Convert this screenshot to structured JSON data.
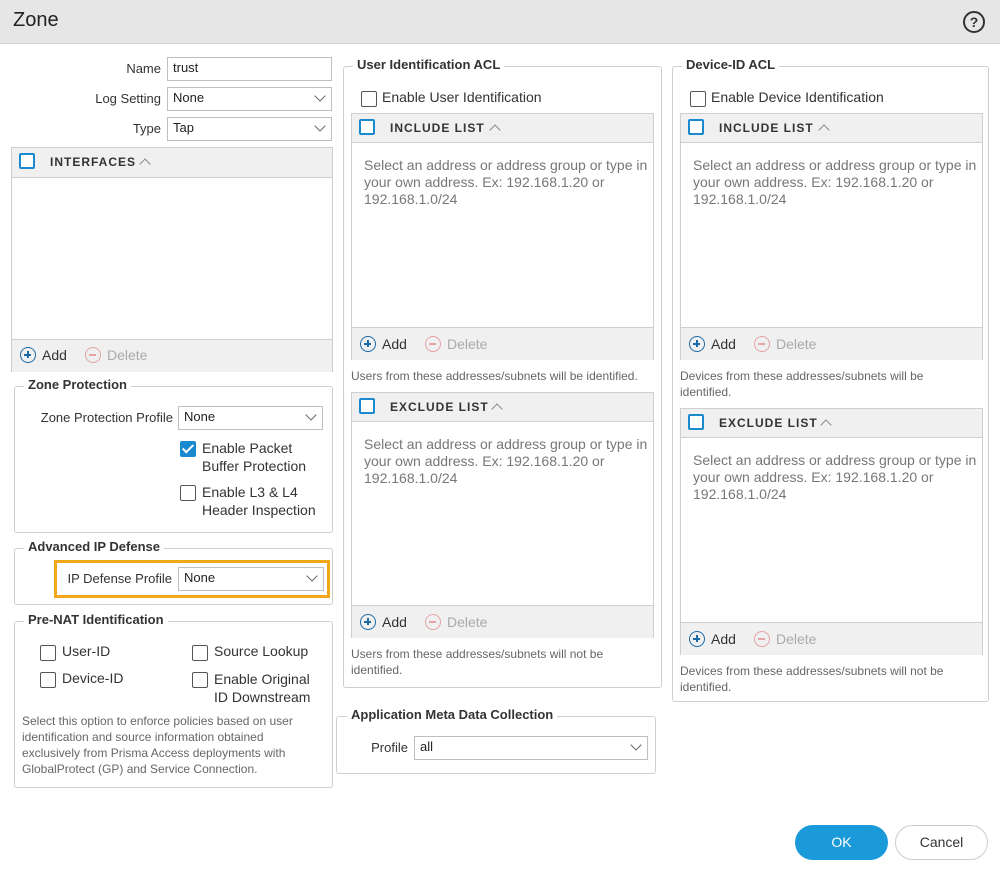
{
  "dialog": {
    "title": "Zone",
    "help_icon": "?"
  },
  "general": {
    "name_label": "Name",
    "name_value": "trust",
    "log_label": "Log Setting",
    "log_value": "None",
    "type_label": "Type",
    "type_value": "Tap"
  },
  "interfaces": {
    "header": "INTERFACES",
    "add": "Add",
    "delete": "Delete"
  },
  "zone_protection": {
    "legend": "Zone Protection",
    "profile_label": "Zone Protection Profile",
    "profile_value": "None",
    "packet_buffer_label_1": "Enable Packet",
    "packet_buffer_label_2": "Buffer Protection",
    "packet_buffer_checked": true,
    "l3l4_label_1": "Enable L3 & L4",
    "l3l4_label_2": "Header Inspection"
  },
  "advanced_ip": {
    "legend": "Advanced IP Defense",
    "profile_label": "IP Defense Profile",
    "profile_value": "None",
    "highlight_color": "#f0a818"
  },
  "prenat": {
    "legend": "Pre-NAT Identification",
    "user_id": "User-ID",
    "device_id": "Device-ID",
    "source_lookup": "Source Lookup",
    "enable_original_1": "Enable Original",
    "enable_original_2": "ID Downstream",
    "note": "Select this option to enforce policies based on user identification and source information obtained exclusively from Prisma Access deployments with GlobalProtect (GP) and Service Connection."
  },
  "user_acl": {
    "legend": "User Identification ACL",
    "enable_label": "Enable User Identification",
    "include_header": "INCLUDE LIST",
    "include_placeholder": "Select an address or address group or type in your own address. Ex: 192.168.1.20 or 192.168.1.0/24",
    "include_note": "Users from these addresses/subnets will be identified.",
    "exclude_header": "EXCLUDE LIST",
    "exclude_placeholder": "Select an address or address group or type in your own address. Ex: 192.168.1.20 or 192.168.1.0/24",
    "exclude_note": "Users from these addresses/subnets will not be identified.",
    "add": "Add",
    "delete": "Delete"
  },
  "device_acl": {
    "legend": "Device-ID ACL",
    "enable_label": "Enable Device Identification",
    "include_header": "INCLUDE LIST",
    "include_placeholder": "Select an address or address group or type in your own address. Ex: 192.168.1.20 or 192.168.1.0/24",
    "include_note": "Devices from these addresses/subnets will be identified.",
    "exclude_header": "EXCLUDE LIST",
    "exclude_placeholder": "Select an address or address group or type in your own address. Ex: 192.168.1.20 or 192.168.1.0/24",
    "exclude_note": "Devices from these addresses/subnets will not be identified.",
    "add": "Add",
    "delete": "Delete"
  },
  "app_meta": {
    "legend": "Application Meta Data Collection",
    "profile_label": "Profile",
    "profile_value": "all"
  },
  "footer": {
    "ok": "OK",
    "cancel": "Cancel"
  },
  "colors": {
    "accent": "#1a9ad8",
    "checkbox_blue": "#1a8ad0"
  }
}
